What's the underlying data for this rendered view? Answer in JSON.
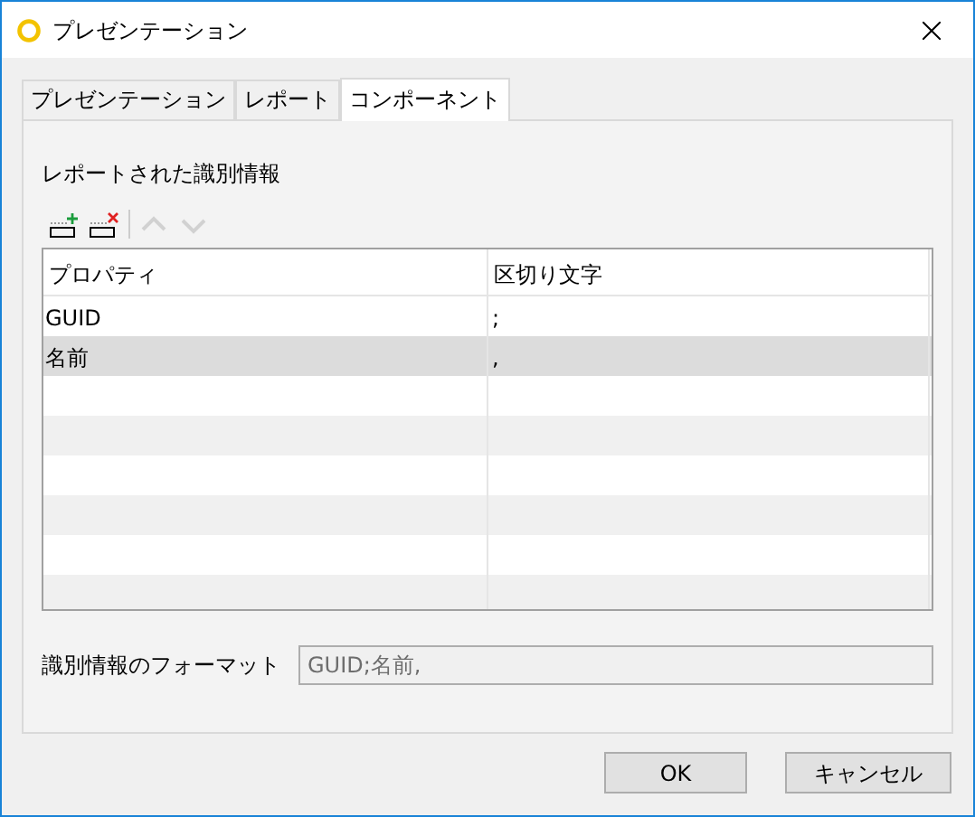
{
  "window": {
    "title": "プレゼンテーション"
  },
  "tabs": [
    {
      "label": "プレゼンテーション",
      "selected": false
    },
    {
      "label": "レポート",
      "selected": false
    },
    {
      "label": "コンポーネント",
      "selected": true
    }
  ],
  "section_label": "レポートされた識別情報",
  "toolbar": [
    {
      "kind": "add",
      "disabled": false
    },
    {
      "kind": "remove",
      "disabled": false
    },
    {
      "kind": "up",
      "disabled": true
    },
    {
      "kind": "down",
      "disabled": true
    }
  ],
  "table": {
    "columns": [
      "プロパティ",
      "区切り文字"
    ],
    "rows": [
      {
        "cells": [
          "GUID",
          ";"
        ],
        "selected": false
      },
      {
        "cells": [
          "名前",
          ","
        ],
        "selected": true
      }
    ]
  },
  "format": {
    "label": "識別情報のフォーマット",
    "value": "GUID;名前,",
    "disabled": true
  },
  "buttons": [
    "OK",
    "キャンセル"
  ]
}
